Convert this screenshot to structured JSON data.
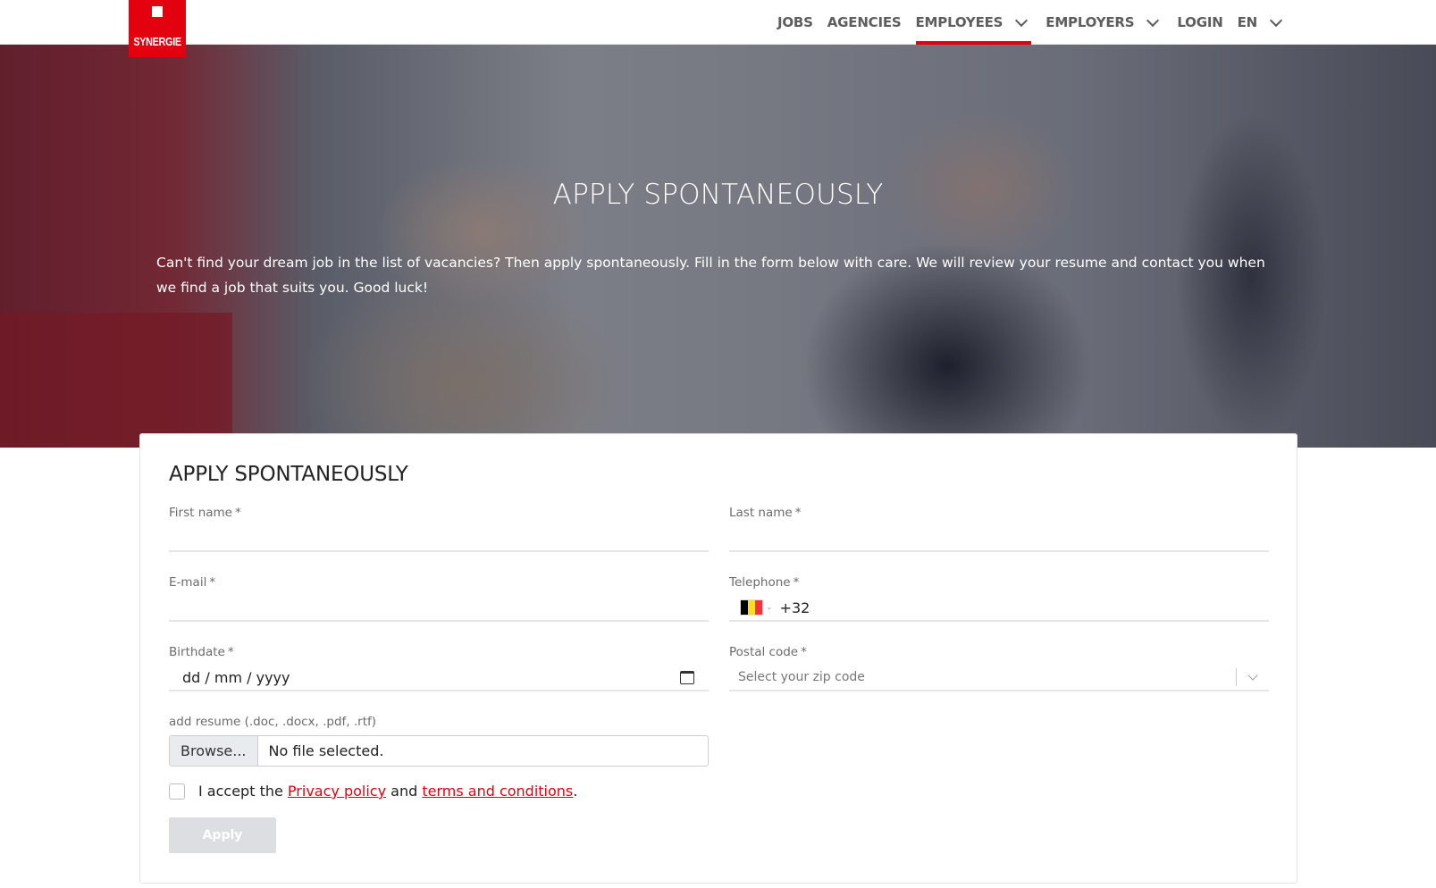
{
  "brand": {
    "logo_text": "SYNERGIE",
    "accent": "#e3000f"
  },
  "nav": {
    "items": [
      {
        "label": "JOBS",
        "dropdown": false,
        "active": false
      },
      {
        "label": "AGENCIES",
        "dropdown": false,
        "active": false
      },
      {
        "label": "EMPLOYEES",
        "dropdown": true,
        "active": true
      },
      {
        "label": "EMPLOYERS",
        "dropdown": true,
        "active": false
      },
      {
        "label": "LOGIN",
        "dropdown": false,
        "active": false
      },
      {
        "label": "EN",
        "dropdown": true,
        "active": false
      }
    ]
  },
  "hero": {
    "title": "APPLY SPONTANEOUSLY",
    "text": "Can't find your dream job in the list of vacancies? Then apply spontaneously. Fill in the form below with care. We will review your resume and contact you when we find a job that suits you. Good luck!"
  },
  "form": {
    "title": "APPLY SPONTANEOUSLY",
    "required_mark": "*",
    "first_name": {
      "label": "First name",
      "value": ""
    },
    "last_name": {
      "label": "Last name",
      "value": ""
    },
    "email": {
      "label": "E-mail",
      "value": ""
    },
    "telephone": {
      "label": "Telephone",
      "value": "+32",
      "flag_icon": "belgium-flag-icon",
      "flag_colors": [
        "#000000",
        "#fdda24",
        "#ef3340"
      ]
    },
    "birthdate": {
      "label": "Birthdate",
      "placeholder": "dd / mm / yyyy",
      "icon": "calendar-icon"
    },
    "postal_code": {
      "label": "Postal code",
      "placeholder": "Select your zip code"
    },
    "resume": {
      "label": "add resume (.doc, .docx, .pdf, .rtf)",
      "browse_label": "Browse...",
      "file_status": "No file selected."
    },
    "consent": {
      "prefix": "I accept the",
      "privacy_link": "Privacy policy",
      "conjunction": "and",
      "terms_link": "terms and conditions",
      "suffix": ".",
      "checked": false
    },
    "submit_label": "Apply"
  }
}
